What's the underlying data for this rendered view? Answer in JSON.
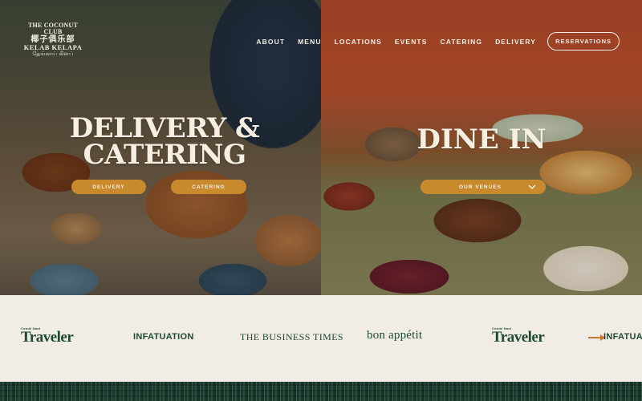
{
  "brand": {
    "logo_line1": "THE COCONUT CLUB",
    "logo_line2": "椰子俱乐部",
    "logo_line3": "KELAB KELAPA",
    "logo_line4": "தேங்காய் கிளப்"
  },
  "nav": {
    "items": [
      {
        "label": "ABOUT"
      },
      {
        "label": "MENU"
      },
      {
        "label": "LOCATIONS"
      },
      {
        "label": "EVENTS"
      },
      {
        "label": "CATERING"
      },
      {
        "label": "DELIVERY"
      }
    ],
    "cta_label": "RESERVATIONS"
  },
  "left_panel": {
    "headline_line1": "DELIVERY &",
    "headline_line2": "CATERING",
    "delivery_button": "DELIVERY",
    "catering_button": "CATERING"
  },
  "right_panel": {
    "headline": "DINE IN",
    "venues_button": "OUR VENUES",
    "venues_icon": "chevron-down-icon"
  },
  "press": {
    "items": [
      {
        "name": "Traveler",
        "sub": "Condé Nast"
      },
      {
        "name": "INFATUATION"
      },
      {
        "name": "THE BUSINESS TIMES"
      },
      {
        "name": "bon appétit"
      },
      {
        "name": "Traveler",
        "sub": "Condé Nast"
      },
      {
        "name": "INFATUATION"
      }
    ]
  },
  "colors": {
    "accent": "#c98a2e",
    "brand_green": "#1e4a34",
    "cream": "#f1ede6",
    "terracotta": "#b8492b"
  }
}
